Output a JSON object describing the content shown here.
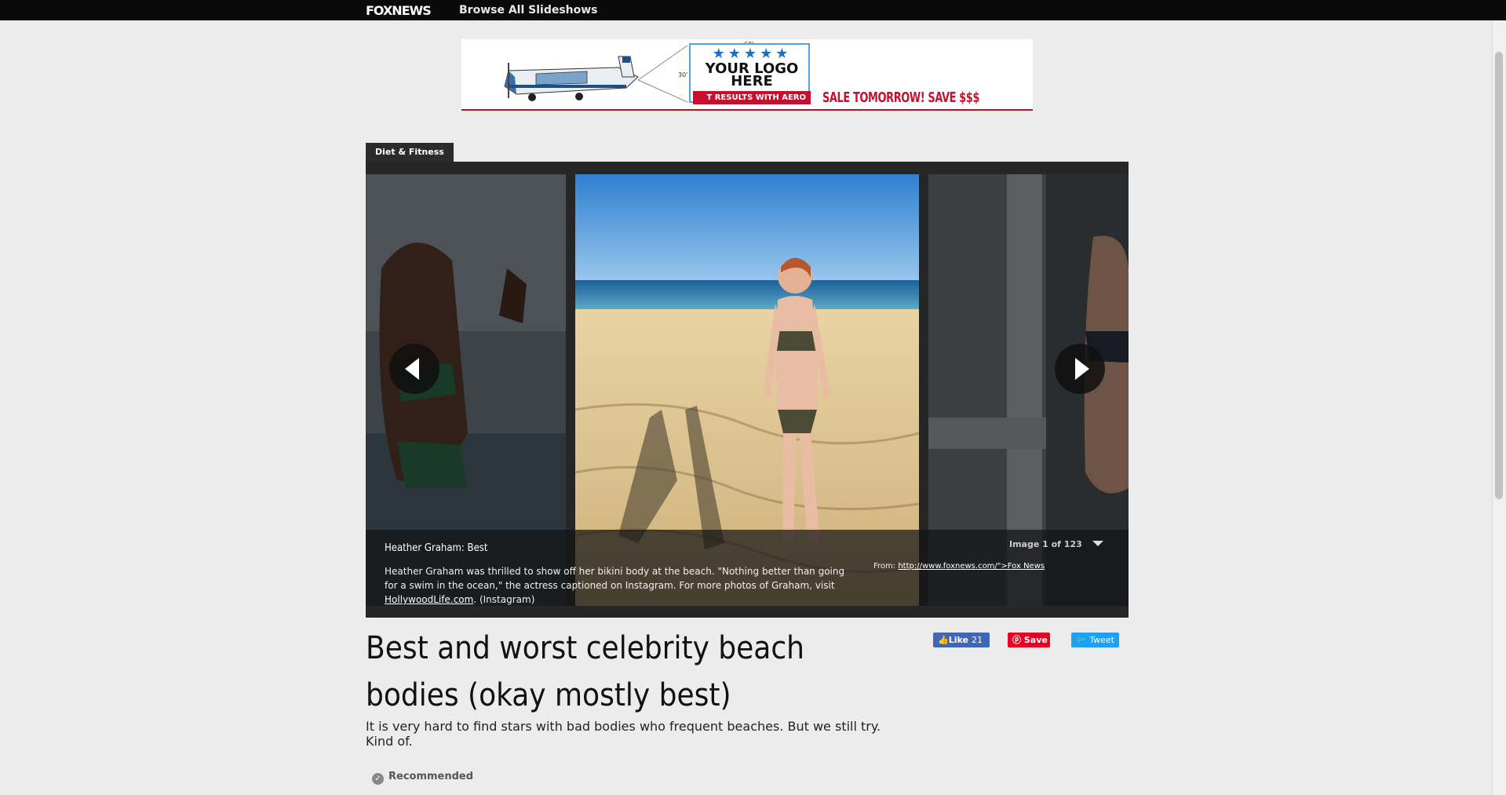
{
  "header": {
    "logo": "FOXNEWS",
    "browse_label": "Browse All Slideshows"
  },
  "ad": {
    "logo_line1": "YOUR LOGO",
    "logo_line2": "HERE",
    "stars": "★★★★★",
    "band_text": "T RESULTS WITH AERO ADS!",
    "sale_text": "SALE TOMORROW! SAVE $$$"
  },
  "slideshow": {
    "category": "Diet & Fitness",
    "caption_title": "Heather Graham: Best",
    "caption_body_pre": "Heather Graham was thrilled to show off her bikini body at the beach. \"Nothing better than going for a swim in the ocean,\" the actress captioned on Instagram. For more photos of Graham, visit ",
    "caption_link": "HollywoodLife.com",
    "caption_body_post": ". (Instagram)",
    "counter": "Image 1 of 123",
    "source_prefix": "From: ",
    "source_link": "http://www.foxnews.com/\">Fox News"
  },
  "article": {
    "headline": "Best and worst celebrity beach bodies (okay mostly best)",
    "dek": "It is very hard to find stars with bad bodies who frequent beaches. But we still try. Kind of.",
    "recommended_label": "Recommended"
  },
  "social": {
    "like_label": "Like",
    "like_count": "21",
    "save_label": "Save",
    "tweet_label": "Tweet"
  },
  "colors": {
    "topbar": "#0a0a0a",
    "background": "#ececec",
    "facebook": "#4267b2",
    "pinterest": "#e60023",
    "twitter": "#1da1f2",
    "ad_red": "#c8102e"
  }
}
